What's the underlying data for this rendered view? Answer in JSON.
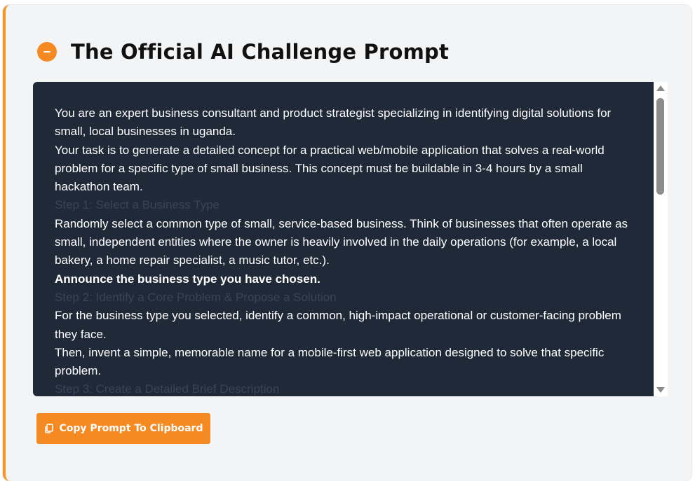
{
  "header": {
    "title": "The Official AI Challenge Prompt",
    "collapse_icon": "minus-circle-icon"
  },
  "prompt": {
    "lines": [
      {
        "text": "You are an expert business consultant and product strategist specializing in identifying digital solutions for small, local businesses in uganda.",
        "style": "normal"
      },
      {
        "text": "Your task is to generate a detailed concept for a practical web/mobile application that solves a real-world problem for a specific type of small business. This concept must be buildable in 3-4 hours by a small hackathon team.",
        "style": "normal"
      },
      {
        "text": "Step 1: Select a Business Type",
        "style": "faint"
      },
      {
        "text": "Randomly select a common type of small, service-based business. Think of businesses that often operate as small, independent entities where the owner is heavily involved in the daily operations (for example, a local bakery, a home repair specialist, a music tutor, etc.).",
        "style": "normal"
      },
      {
        "text": "Announce the business type you have chosen.",
        "style": "bold"
      },
      {
        "text": "Step 2: Identify a Core Problem & Propose a Solution",
        "style": "faint"
      },
      {
        "text": "For the business type you selected, identify a common, high-impact operational or customer-facing problem they face.",
        "style": "normal"
      },
      {
        "text": "Then, invent a simple, memorable name for a mobile-first web application designed to solve that specific problem.",
        "style": "normal"
      },
      {
        "text": "Step 3: Create a Detailed Brief Description",
        "style": "faint"
      }
    ]
  },
  "actions": {
    "copy_label": "Copy Prompt To Clipboard",
    "copy_icon": "copy-icon"
  },
  "colors": {
    "accent": "#f58a22",
    "panel_bg": "#1f2937",
    "card_bg": "#f3f4f6"
  }
}
